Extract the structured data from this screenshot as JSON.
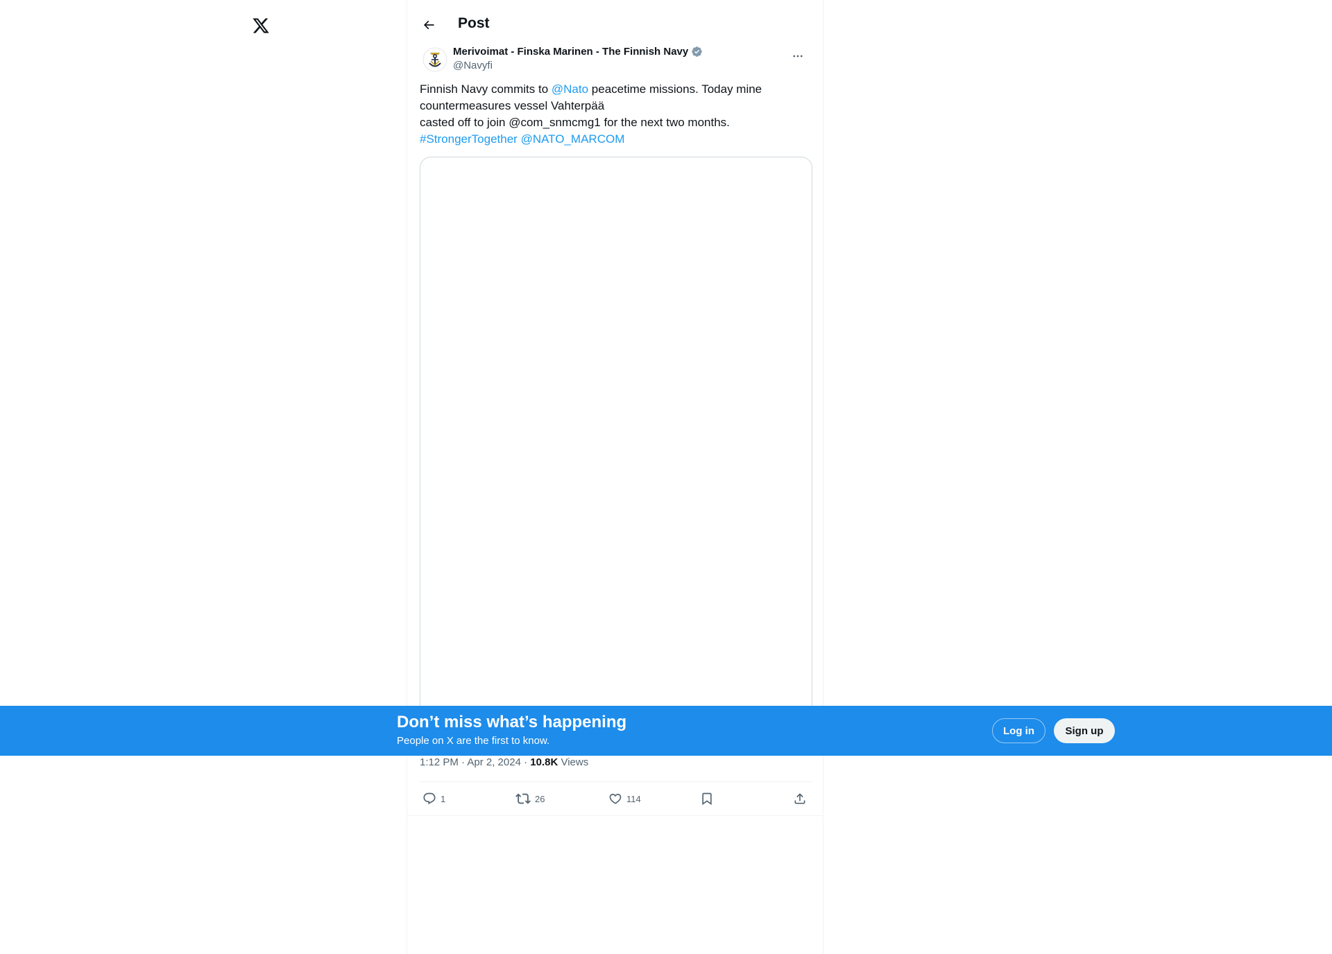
{
  "header": {
    "title": "Post"
  },
  "tweet": {
    "author": {
      "name": "Merivoimat - Finska Marinen - The Finnish Navy",
      "handle": "@Navyfi",
      "verified_icon": "verified-badge-icon"
    },
    "text": {
      "line1_pre": "Finnish Navy commits to ",
      "line1_mention": "@Nato",
      "line1_post": " peacetime missions. Today mine",
      "line2": "countermeasures vessel Vahterpää",
      "line3": "casted off to join @com_snmcmg1 for the next two months.",
      "line4_hashtag": "#StrongerTogether",
      "line4_mention": "@NATO_MARCOM"
    },
    "meta": {
      "time_date": "1:12 PM · Apr 2, 2024 · ",
      "views_count": "10.8K",
      "views_label": "Views"
    },
    "actions": {
      "replies": "1",
      "reposts": "26",
      "likes": "114"
    }
  },
  "banner": {
    "title": "Don’t miss what’s happening",
    "subtitle": "People on X are the first to know.",
    "login_label": "Log in",
    "signup_label": "Sign up"
  },
  "colors": {
    "accent": "#1d9bf0",
    "banner": "#1d8ceb",
    "text_primary": "#0f1419",
    "text_secondary": "#536471"
  }
}
